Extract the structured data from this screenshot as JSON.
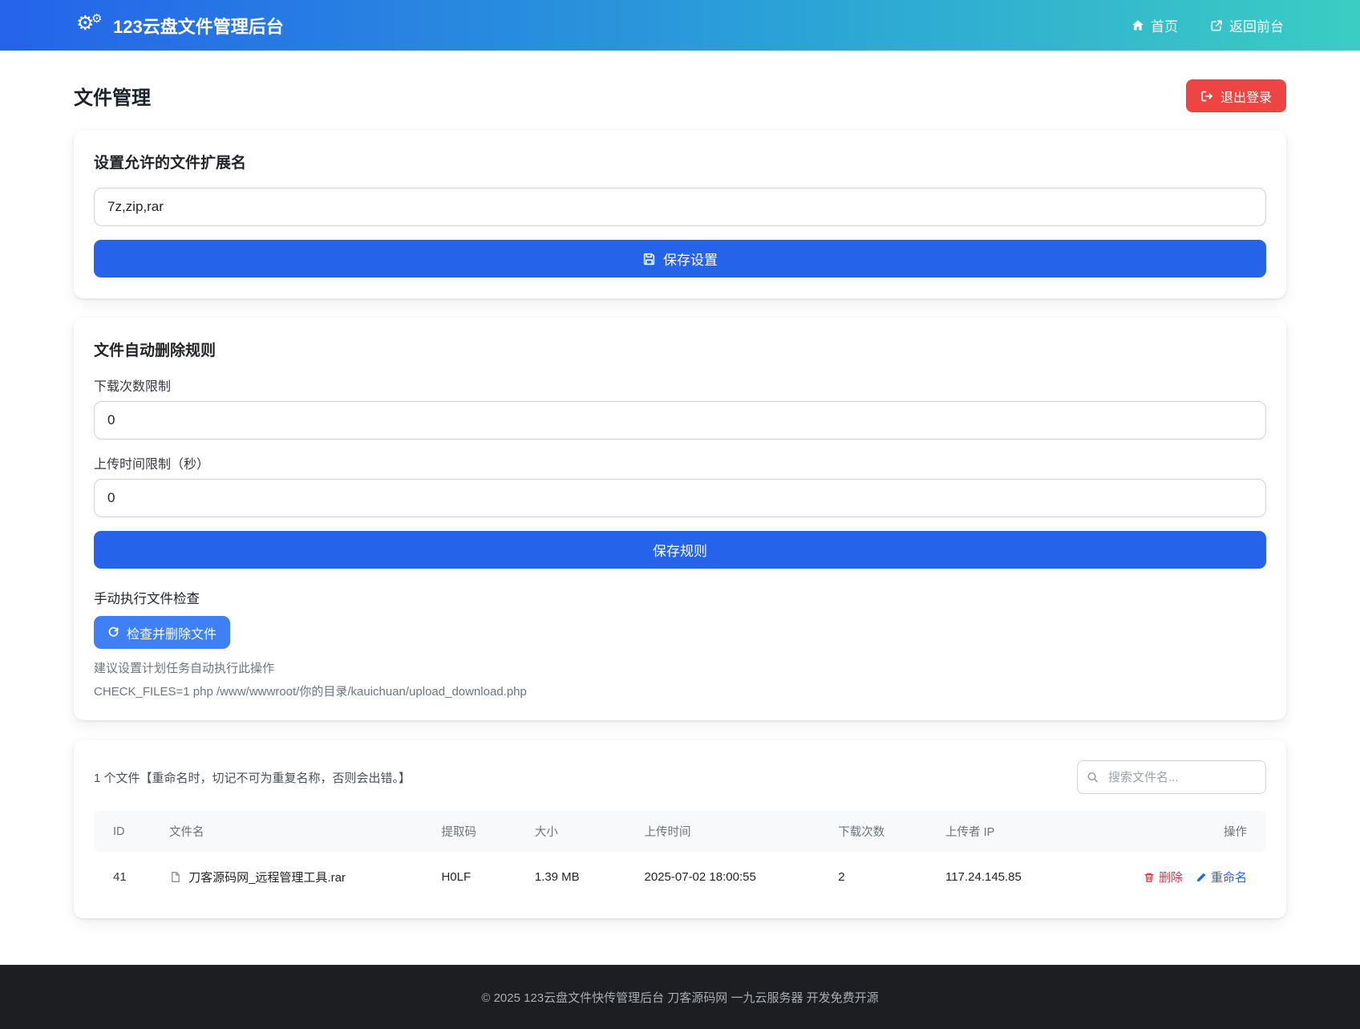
{
  "navbar": {
    "brand": "123云盘文件管理后台",
    "links": [
      {
        "label": "首页",
        "icon": "home-icon"
      },
      {
        "label": "返回前台",
        "icon": "external-link-icon"
      }
    ]
  },
  "header": {
    "title": "文件管理",
    "logout_label": "退出登录"
  },
  "extension_card": {
    "title": "设置允许的文件扩展名",
    "input_value": "7z,zip,rar",
    "save_label": "保存设置"
  },
  "rules_card": {
    "title": "文件自动删除规则",
    "download_limit_label": "下载次数限制",
    "download_limit_value": "0",
    "upload_time_label": "上传时间限制（秒）",
    "upload_time_value": "0",
    "save_label": "保存规则",
    "manual_check_label": "手动执行文件检查",
    "check_button_label": "检查并删除文件",
    "hint1": "建议设置计划任务自动执行此操作",
    "hint2": "CHECK_FILES=1 php /www/wwwroot/你的目录/kauichuan/upload_download.php"
  },
  "files_card": {
    "summary": "1 个文件【重命名时，切记不可为重复名称，否则会出错。】",
    "search_placeholder": "搜索文件名...",
    "table": {
      "headers": [
        "ID",
        "文件名",
        "提取码",
        "大小",
        "上传时间",
        "下载次数",
        "上传者 IP",
        "操作"
      ],
      "rows": [
        {
          "id": "41",
          "filename": "刀客源码网_远程管理工具.rar",
          "code": "H0LF",
          "size": "1.39 MB",
          "upload_time": "2025-07-02 18:00:55",
          "downloads": "2",
          "uploader_ip": "117.24.145.85",
          "delete_label": "删除",
          "rename_label": "重命名"
        }
      ]
    }
  },
  "footer": {
    "text": "© 2025 123云盘文件快传管理后台 刀客源码网 一九云服务器 开发免费开源"
  },
  "colors": {
    "navbar_gradient_start": "#2563eb",
    "navbar_gradient_end": "#3bcdc3",
    "primary_button": "#2563eb",
    "check_button": "#3f80f7",
    "logout_button": "#ef4444",
    "delete_link": "#dc3545",
    "rename_link": "#2563eb",
    "footer_background": "#1c1e21"
  }
}
